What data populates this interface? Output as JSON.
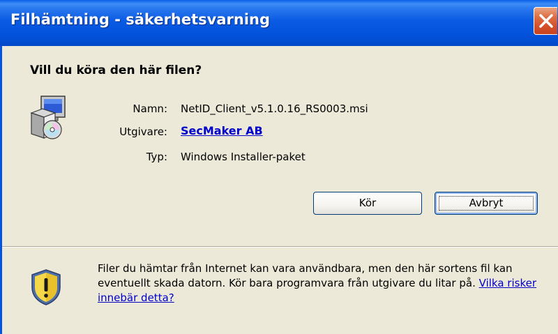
{
  "window": {
    "title": "Filhämtning - säkerhetsvarning"
  },
  "dialog": {
    "question": "Vill du köra den här filen?",
    "file_icon": "installer-package-icon",
    "name_label": "Namn:",
    "name_value": "NetID_Client_v5.1.0.16_RS0003.msi",
    "publisher_label": "Utgivare:",
    "publisher_value": "SecMaker AB",
    "type_label": "Typ:",
    "type_value": "Windows Installer-paket",
    "run_button": "Kör",
    "cancel_button": "Avbryt"
  },
  "warning": {
    "icon": "security-shield-warning-icon",
    "text": "Filer du hämtar från Internet kan vara användbara, men den här sortens fil kan eventuellt skada datorn. Kör bara programvara från utgivare du litar på.",
    "link": "Vilka risker innebär detta?"
  },
  "colors": {
    "titlebar": "#0054e3",
    "close_button": "#d3502b",
    "background": "#ece9d8",
    "link": "#0000cc"
  }
}
